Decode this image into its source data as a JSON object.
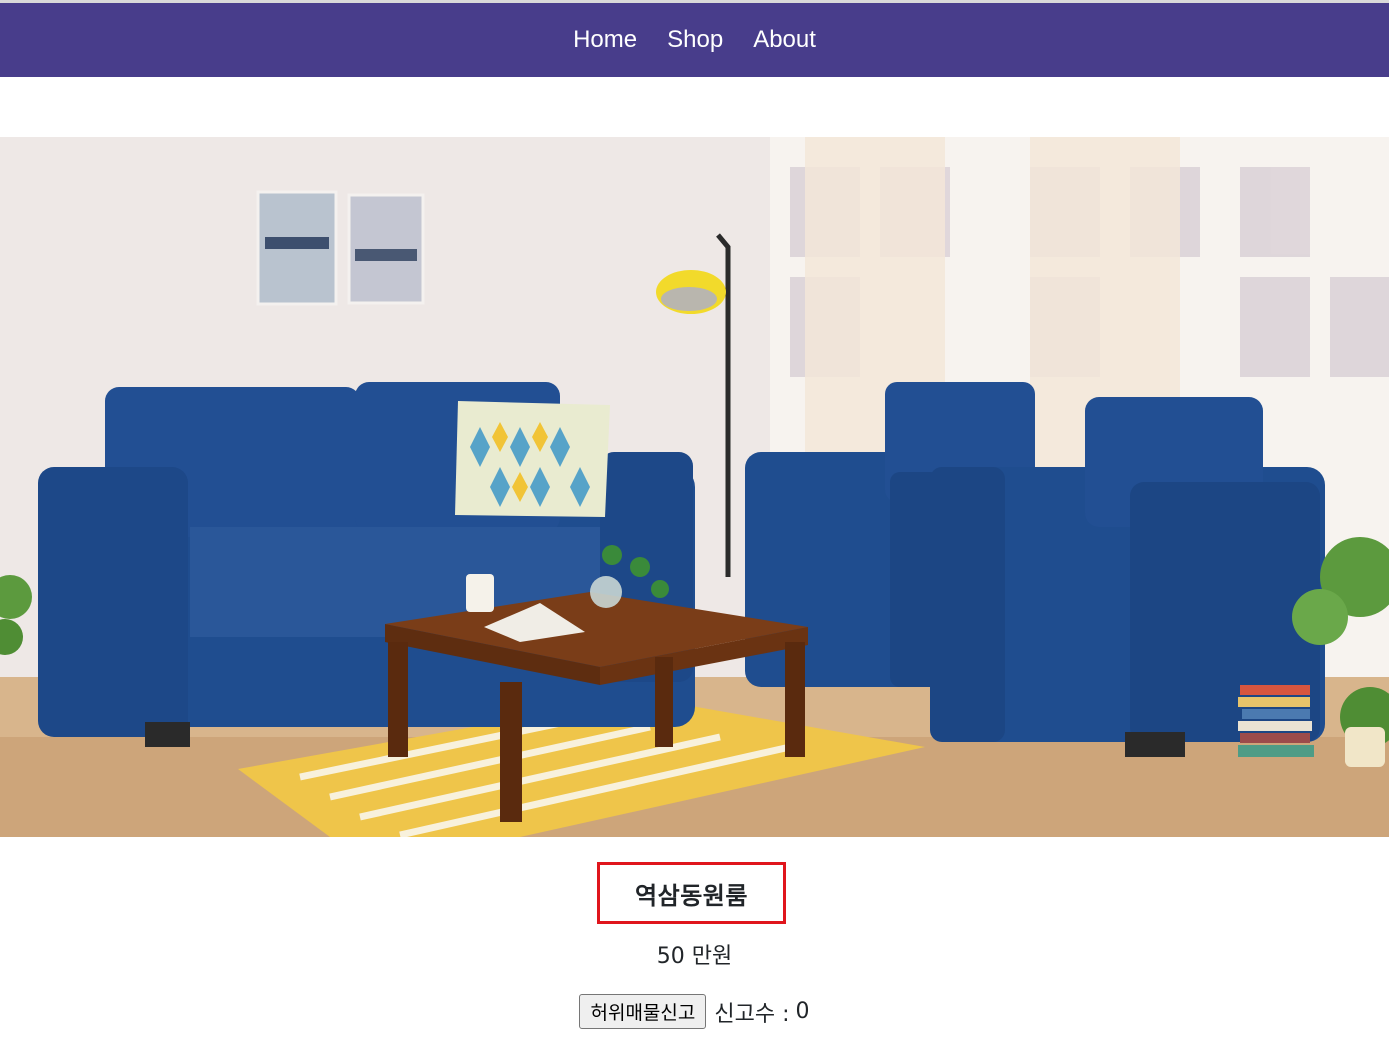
{
  "nav": {
    "items": [
      {
        "label": "Home"
      },
      {
        "label": "Shop"
      },
      {
        "label": "About"
      }
    ]
  },
  "colors": {
    "navbar": "#483d8b",
    "title_border": "#e0151c"
  },
  "product": {
    "title": "역삼동원룸",
    "price": "50 만원",
    "report_button_label": "허위매물신고",
    "report_count_label": "신고수 :",
    "report_count": "0"
  }
}
